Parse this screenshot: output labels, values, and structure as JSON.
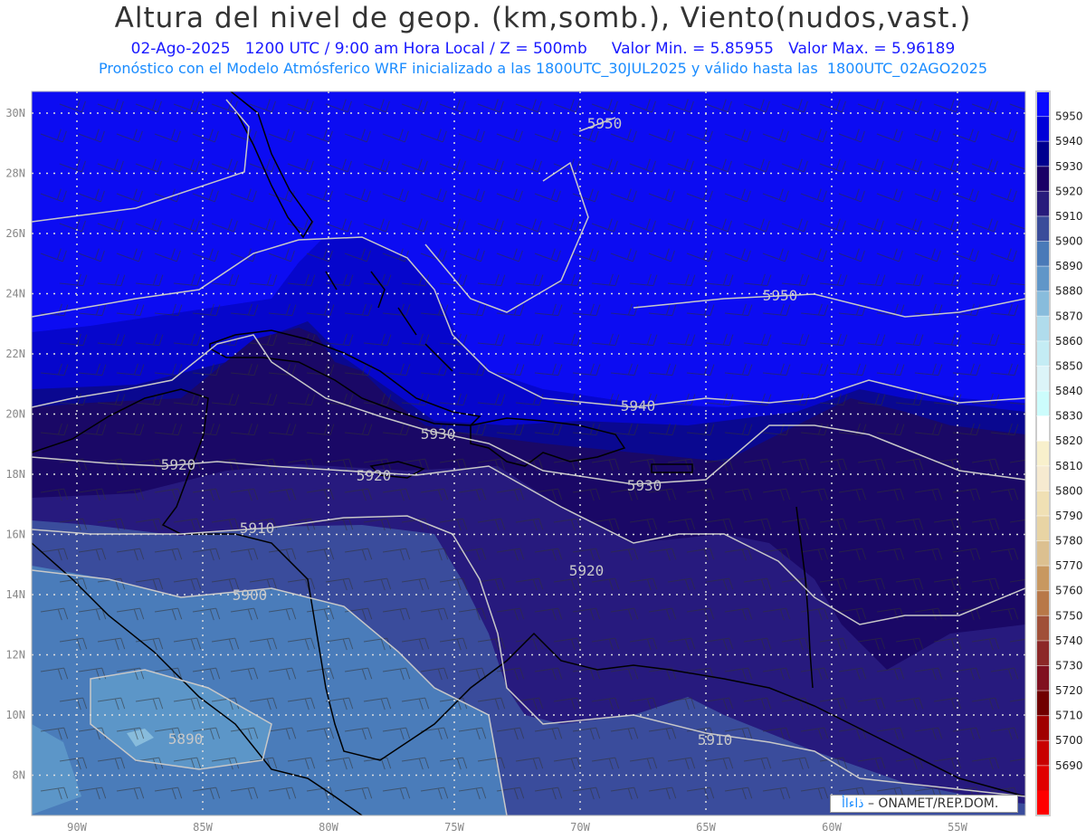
{
  "header": {
    "title": "Altura del nivel de geop. (km,somb.), Viento(nudos,vast.)",
    "subtitle": "02-Ago-2025   1200 UTC / 9:00 am Hora Local / Z = 500mb     Valor Min. = 5.85955   Valor Max. = 5.96189",
    "model_info": "Pronóstico con el Modelo Atmósferico WRF inicializado a las 1800UTC_30JUL2025 y válido hasta las  1800UTC_02AGO2025"
  },
  "axes": {
    "lat_labels": [
      {
        "v": 30,
        "t": "30N"
      },
      {
        "v": 28,
        "t": "28N"
      },
      {
        "v": 26,
        "t": "26N"
      },
      {
        "v": 24,
        "t": "24N"
      },
      {
        "v": 22,
        "t": "22N"
      },
      {
        "v": 20,
        "t": "20N"
      },
      {
        "v": 18,
        "t": "18N"
      },
      {
        "v": 16,
        "t": "16N"
      },
      {
        "v": 14,
        "t": "14N"
      },
      {
        "v": 12,
        "t": "12N"
      },
      {
        "v": 10,
        "t": "10N"
      },
      {
        "v": 8,
        "t": "8N"
      }
    ],
    "lon_labels": [
      {
        "v": 90,
        "t": "90W"
      },
      {
        "v": 85,
        "t": "85W"
      },
      {
        "v": 80,
        "t": "80W"
      },
      {
        "v": 75,
        "t": "75W"
      },
      {
        "v": 70,
        "t": "70W"
      },
      {
        "v": 65,
        "t": "65W"
      },
      {
        "v": 60,
        "t": "60W"
      },
      {
        "v": 55,
        "t": "55W"
      }
    ]
  },
  "contour_labels": [
    "5950",
    "5950",
    "5940",
    "5930",
    "5920",
    "5920",
    "5930",
    "5910",
    "5920",
    "5900",
    "5890",
    "5910"
  ],
  "colorbar": {
    "labels": [
      "5950",
      "5940",
      "5930",
      "5920",
      "5910",
      "5900",
      "5890",
      "5880",
      "5870",
      "5860",
      "5850",
      "5840",
      "5830",
      "5820",
      "5810",
      "5800",
      "5790",
      "5780",
      "5770",
      "5760",
      "5750",
      "5740",
      "5730",
      "5720",
      "5710",
      "5700",
      "5690"
    ],
    "colors": [
      "#0a0aff",
      "#0000d8",
      "#00008f",
      "#1a0066",
      "#281c7c",
      "#3a4c9a",
      "#4a7ab8",
      "#6096c8",
      "#88bcdc",
      "#b0dcec",
      "#c4ecf4",
      "#dcf4f8",
      "#ccfcfc",
      "#ffffff",
      "#f8f0cc",
      "#f6ead0",
      "#f0e0b4",
      "#e8d4a4",
      "#dcc090",
      "#c89860",
      "#b87848",
      "#a05038",
      "#8c2828",
      "#801020",
      "#700000",
      "#a00000",
      "#c80000",
      "#e00000",
      "#ff0000"
    ]
  },
  "credit": {
    "logo": "ذاءاأ",
    "text": " – ONAMET/REP.DOM."
  }
}
